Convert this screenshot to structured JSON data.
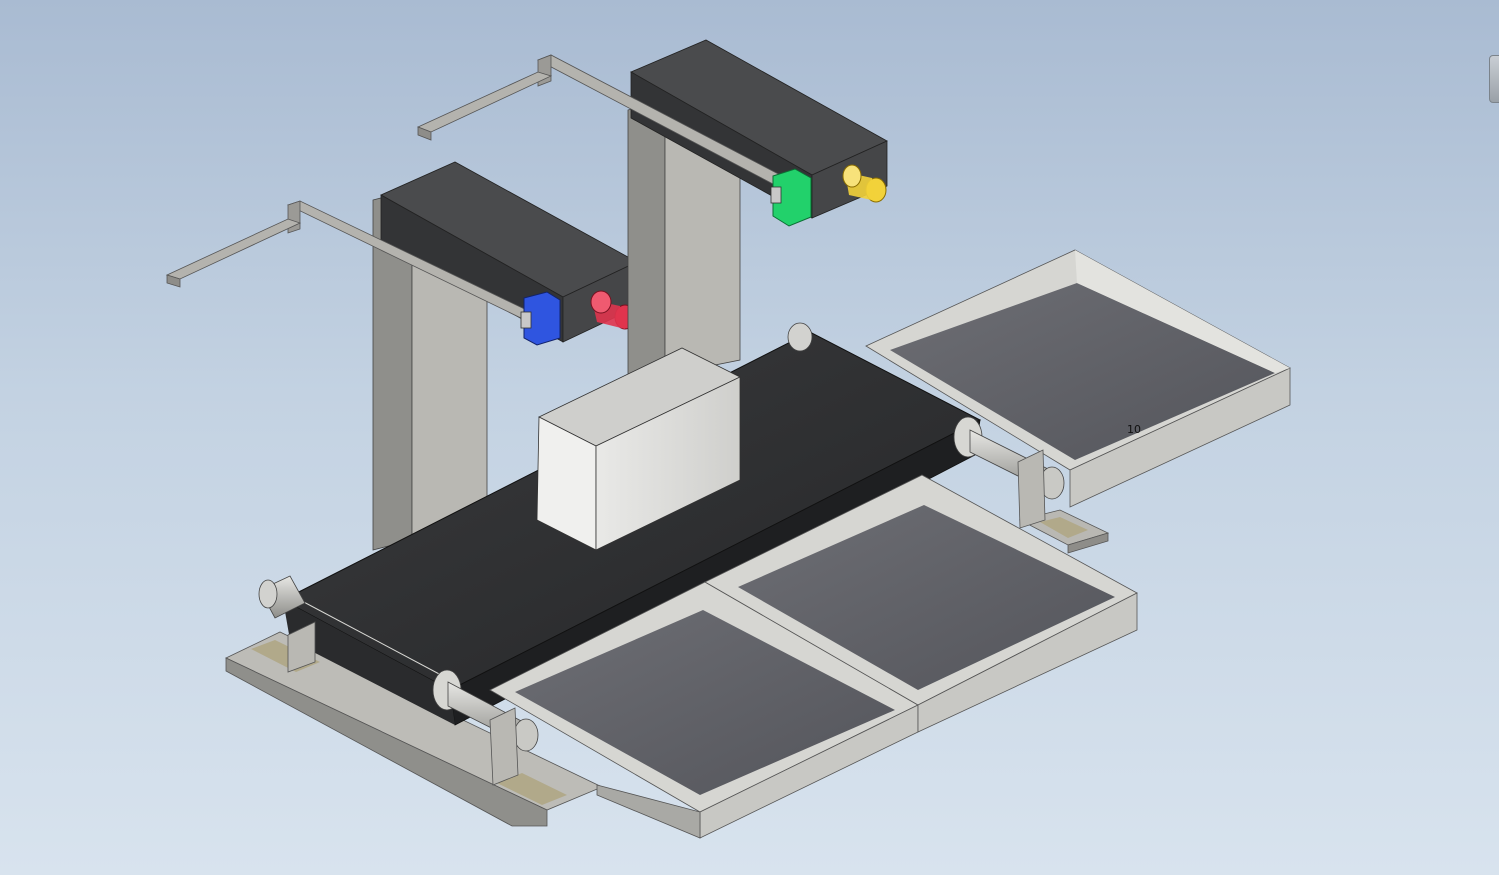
{
  "viewport": {
    "background_top": "#a9bbd2",
    "background_bottom": "#d8e3ee"
  },
  "scene": {
    "dimension_label": "10",
    "colors": {
      "belt": "#2e2f31",
      "metal": "#bdbcb7",
      "dark_box": "#3c3d3f",
      "tray_floor": "#5f6066",
      "sensor_blue": "#2f55e0",
      "sensor_red": "#e0344e",
      "sensor_green": "#22d16b",
      "sensor_yellow": "#f2d23a"
    }
  }
}
